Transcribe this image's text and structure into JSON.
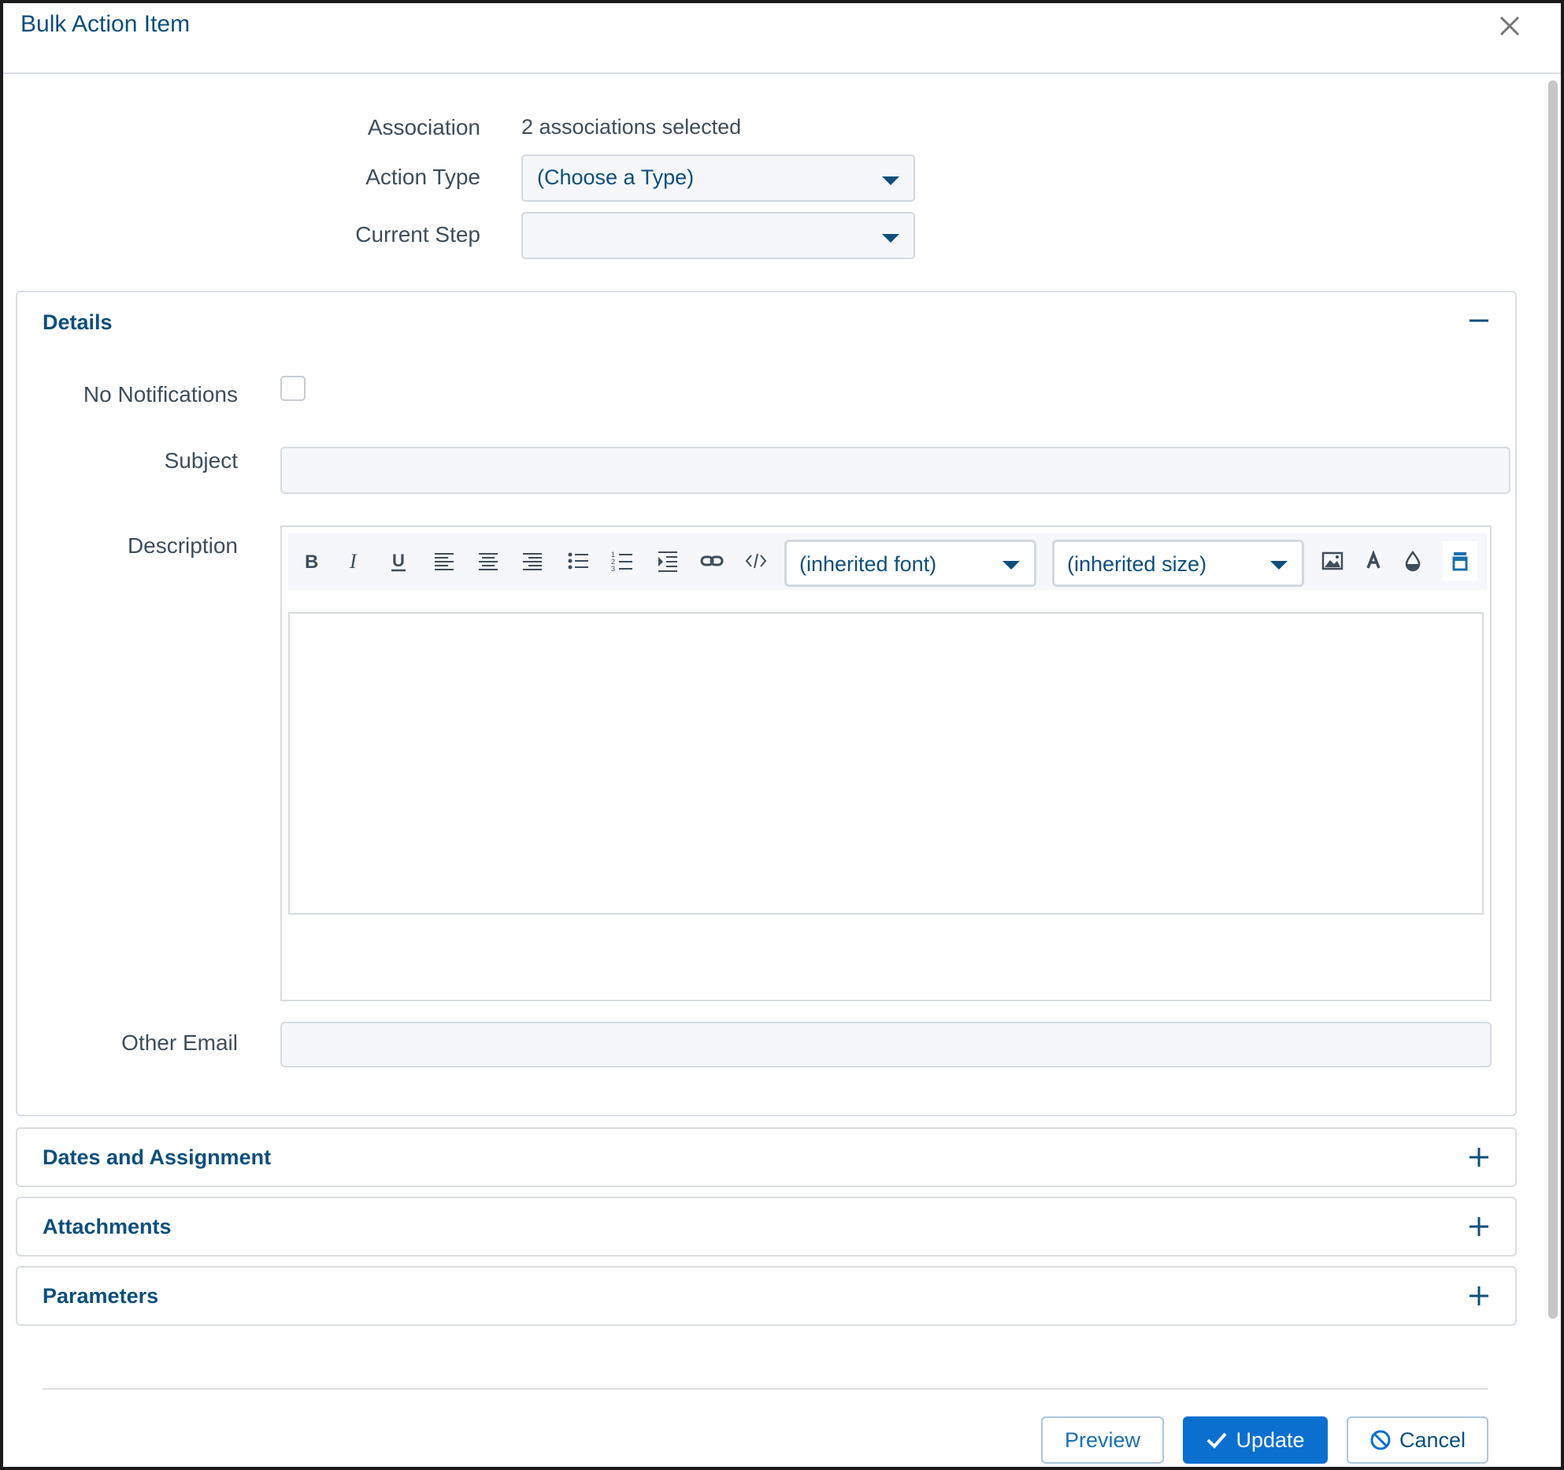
{
  "dialog": {
    "title": "Bulk Action Item",
    "close_icon": "close-icon"
  },
  "top": {
    "association_label": "Association",
    "association_value": "2 associations selected",
    "action_type_label": "Action Type",
    "action_type_value": "(Choose a Type)",
    "current_step_label": "Current Step",
    "current_step_value": ""
  },
  "details": {
    "title": "Details",
    "toggle_icon": "minus-icon",
    "no_notifications_label": "No Notifications",
    "no_notifications_checked": false,
    "subject_label": "Subject",
    "subject_value": "",
    "description_label": "Description",
    "other_email_label": "Other Email",
    "other_email_value": ""
  },
  "editor": {
    "toolbar_icons": [
      "bold-icon",
      "italic-icon",
      "underline-icon",
      "align-left-icon",
      "align-center-icon",
      "align-right-icon",
      "bullet-list-icon",
      "numbered-list-icon",
      "indent-icon",
      "link-icon",
      "code-icon",
      "image-icon",
      "font-color-icon",
      "background-color-icon",
      "fullscreen-icon"
    ],
    "font_select_value": "(inherited font)",
    "size_select_value": "(inherited size)"
  },
  "sections": {
    "dates_title": "Dates and Assignment",
    "attachments_title": "Attachments",
    "parameters_title": "Parameters",
    "expand_icon": "plus-icon"
  },
  "footer": {
    "preview_label": "Preview",
    "update_label": "Update",
    "cancel_label": "Cancel"
  },
  "colors": {
    "brand": "#0d4f7c",
    "primary_button": "#0b6fd0",
    "label_text": "#3f4d5a",
    "border": "#d9dde2"
  }
}
